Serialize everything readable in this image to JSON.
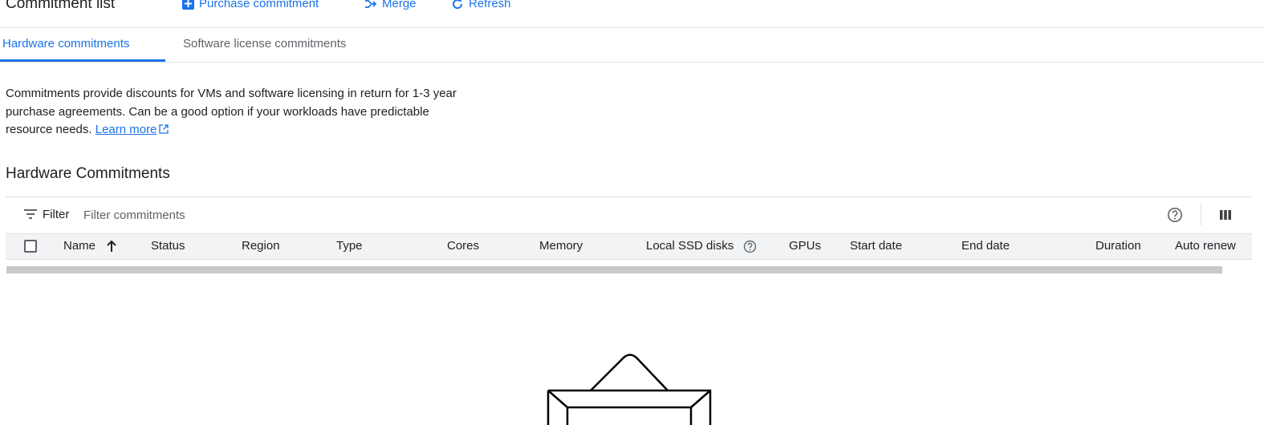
{
  "header": {
    "title": "Commitment list",
    "actions": [
      {
        "label": "Purchase commitment",
        "icon": "add-box-icon"
      },
      {
        "label": "Merge",
        "icon": "merge-icon"
      },
      {
        "label": "Refresh",
        "icon": "refresh-icon"
      }
    ]
  },
  "tabs": [
    {
      "label": "Hardware commitments",
      "active": true
    },
    {
      "label": "Software license commitments",
      "active": false
    }
  ],
  "description": {
    "text": "Commitments provide discounts for VMs and software licensing in return for 1-3 year purchase agreements. Can be a good option if your workloads have predictable resource needs.",
    "link": "Learn more",
    "link_icon": "open-in-new-icon"
  },
  "section": {
    "title": "Hardware Commitments"
  },
  "filter": {
    "label": "Filter",
    "placeholder": "Filter commitments",
    "value": ""
  },
  "table": {
    "columns": [
      {
        "label": "Name",
        "sort": "ascending"
      },
      {
        "label": "Status"
      },
      {
        "label": "Region"
      },
      {
        "label": "Type"
      },
      {
        "label": "Cores"
      },
      {
        "label": "Memory"
      },
      {
        "label": "Local SSD disks",
        "help_icon": "help-icon"
      },
      {
        "label": "GPUs"
      },
      {
        "label": "Start date"
      },
      {
        "label": "End date"
      },
      {
        "label": "Duration"
      },
      {
        "label": "Auto renew"
      }
    ],
    "rows": []
  },
  "colors": {
    "accent": "#1a73e8",
    "text": "#202124",
    "secondary_text": "#5f6368",
    "header_bg": "#f1f3f4",
    "divider": "#e0e0e0"
  }
}
